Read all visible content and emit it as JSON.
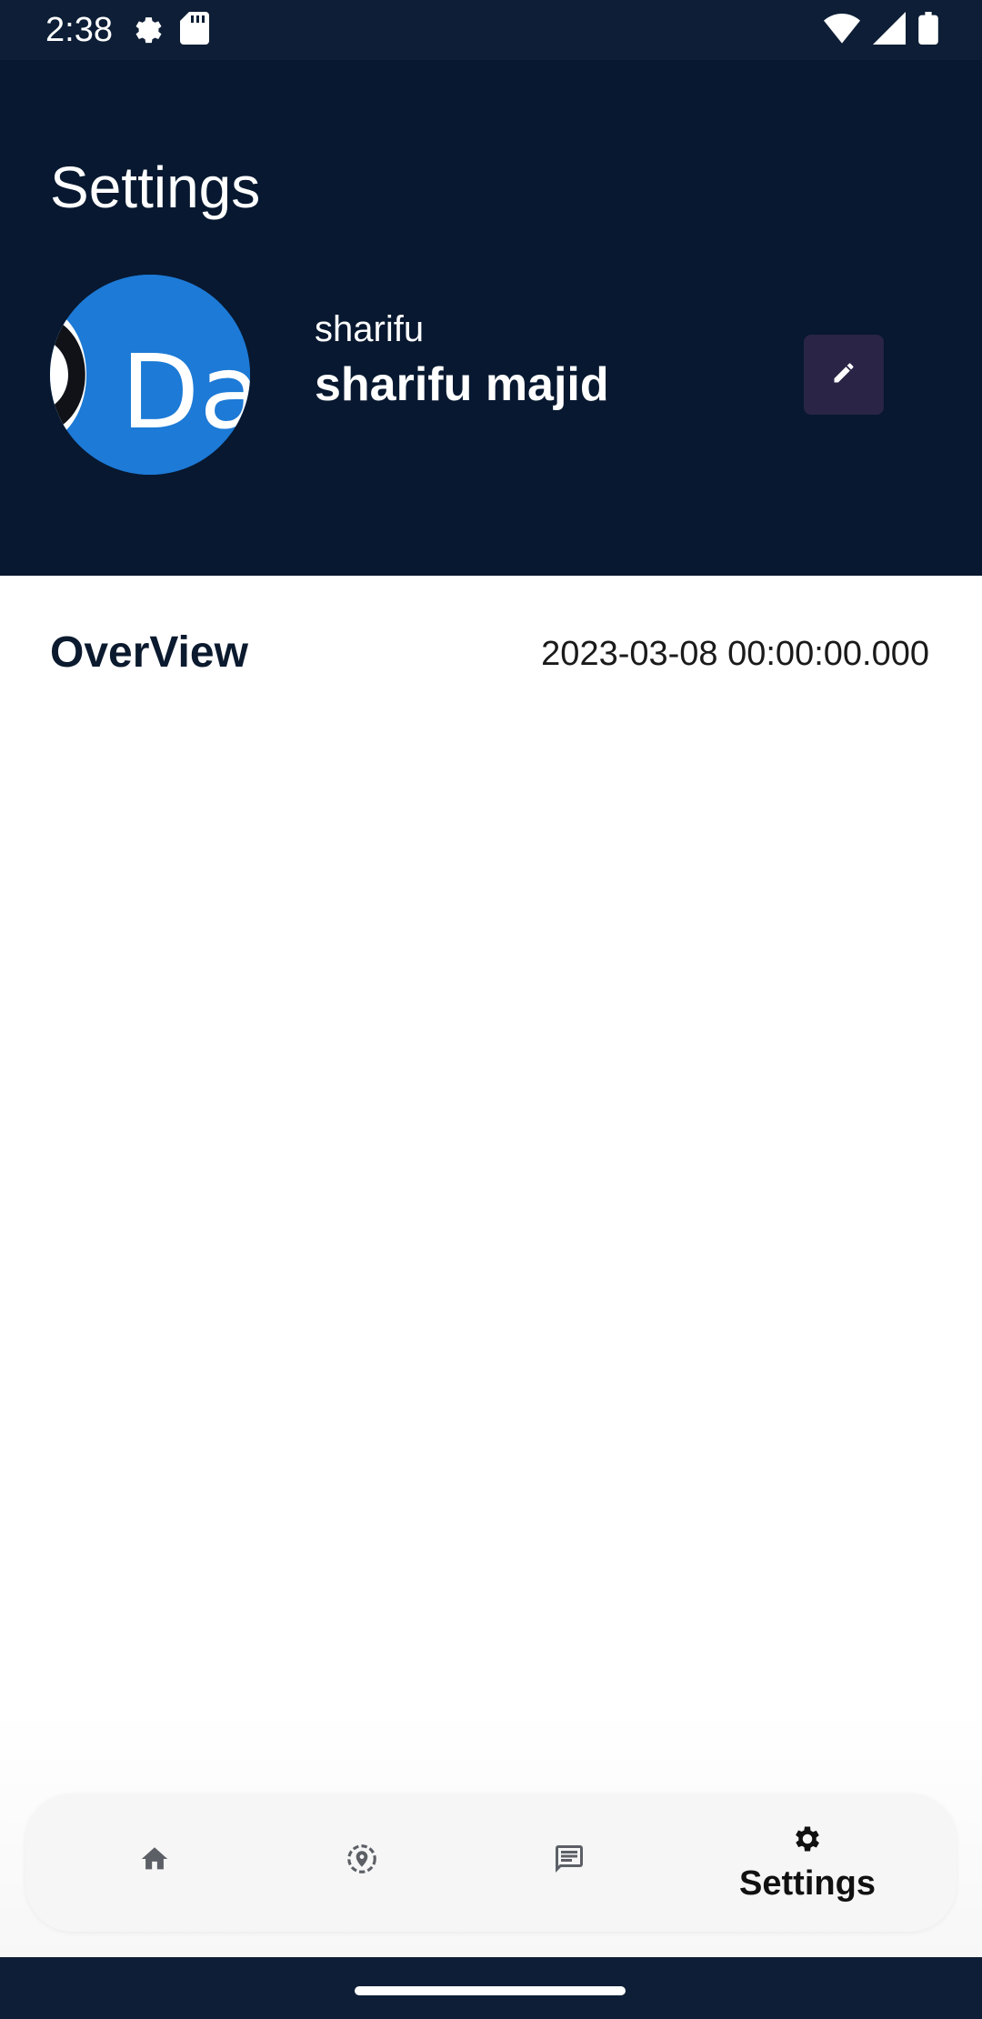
{
  "status_bar": {
    "time": "2:38",
    "left_icons": [
      "settings-gear-icon",
      "sd-card-icon"
    ],
    "right_icons": [
      "wifi-icon",
      "signal-icon",
      "battery-icon"
    ]
  },
  "header": {
    "title": "Settings",
    "avatar_text": "Dala",
    "username": "sharifu",
    "full_name": "sharifu majid",
    "edit_icon": "pencil-icon"
  },
  "overview": {
    "title": "OverView",
    "date": "2023-03-08 00:00:00.000"
  },
  "bottom_nav": {
    "items": [
      {
        "icon": "home-icon",
        "label": ""
      },
      {
        "icon": "location-icon",
        "label": ""
      },
      {
        "icon": "chat-icon",
        "label": ""
      },
      {
        "icon": "gear-icon",
        "label": "Settings",
        "active": true
      }
    ]
  },
  "colors": {
    "header_bg": "#071830",
    "status_bg": "#0d1e36",
    "avatar_blue": "#1d7ad6",
    "edit_button_bg": "#2a2446",
    "nav_bg": "#f6f6f6"
  }
}
